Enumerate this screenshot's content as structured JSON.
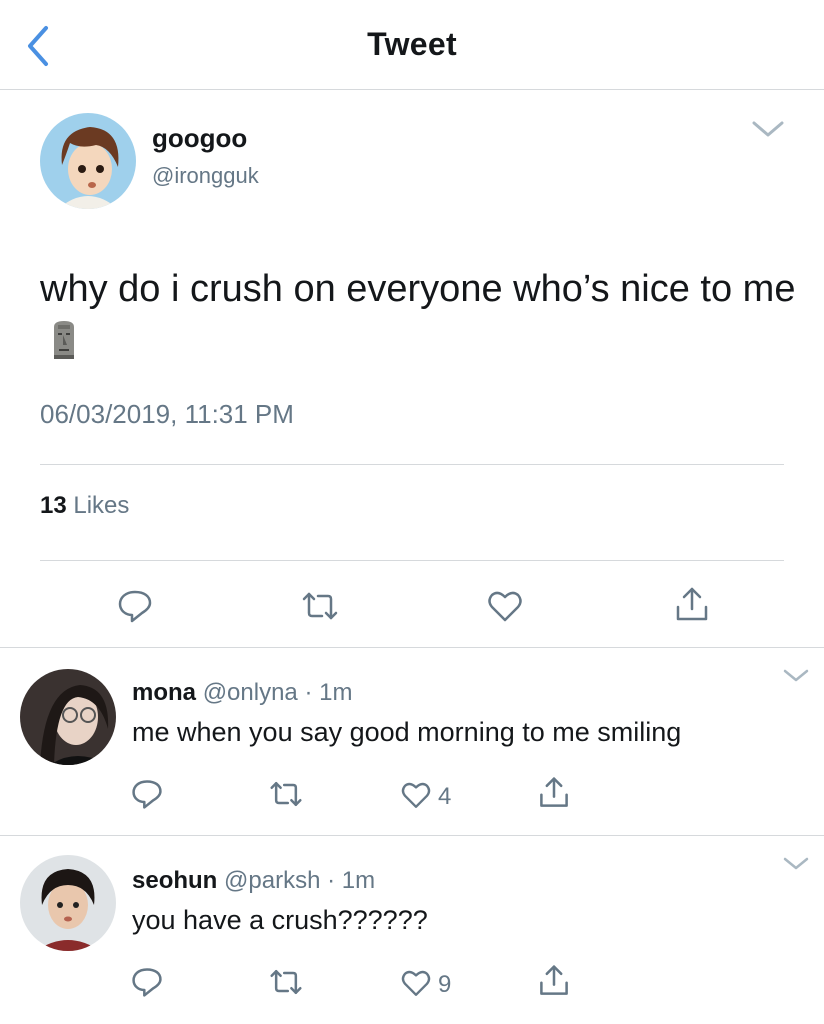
{
  "header": {
    "title": "Tweet",
    "back_icon": "chevron-left-icon",
    "accent_color": "#4a90e2"
  },
  "main_tweet": {
    "name": "googoo",
    "handle": "@irongguk",
    "text": "why do i crush on everyone who’s nice to me",
    "emoji": "moai-emoji",
    "timestamp": "06/03/2019, 11:31 PM",
    "likes_count": "13",
    "likes_label": "Likes",
    "actions": [
      "reply-icon",
      "retweet-icon",
      "like-icon",
      "share-icon"
    ]
  },
  "replies": [
    {
      "name": "mona",
      "handle": "@onlyna",
      "separator": "·",
      "time": "1m",
      "text": "me when you say good morning to me smiling",
      "like_count": "4"
    },
    {
      "name": "seohun",
      "handle": "@parksh",
      "separator": "·",
      "time": "1m",
      "text": "you have a crush??????",
      "like_count": "9"
    }
  ],
  "colors": {
    "text_primary": "#14171a",
    "text_secondary": "#657786",
    "divider": "#d6d9dc"
  }
}
